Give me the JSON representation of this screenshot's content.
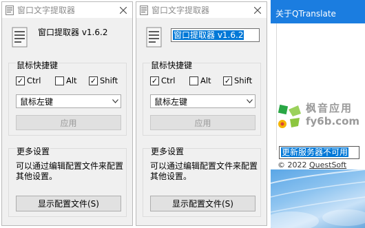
{
  "windows": [
    {
      "title": "窗口文字提取器",
      "app_title": "窗口提取器 v1.6.2",
      "app_title_selected": false,
      "hotkey_group": "鼠标快捷键",
      "checkboxes": [
        {
          "label": "Ctrl",
          "checked": true
        },
        {
          "label": "Alt",
          "checked": false
        },
        {
          "label": "Shift",
          "checked": true
        }
      ],
      "combo_value": "鼠标左键",
      "apply_label": "应用",
      "more_group": "更多设置",
      "more_text": "可以通过编辑配置文件来配置其他设置。",
      "show_config_label": "显示配置文件(S)"
    },
    {
      "title": "窗口文字提取器",
      "app_title": "窗口提取器 v1.6.2",
      "app_title_selected": true,
      "hotkey_group": "鼠标快捷键",
      "checkboxes": [
        {
          "label": "Ctrl",
          "checked": true
        },
        {
          "label": "Alt",
          "checked": false
        },
        {
          "label": "Shift",
          "checked": true
        }
      ],
      "combo_value": "鼠标左键",
      "apply_label": "应用",
      "more_group": "更多设置",
      "more_text": "可以通过编辑配置文件来配置其他设置。",
      "show_config_label": "显示配置文件(S)"
    }
  ],
  "about": {
    "title": "关于QTranslate",
    "watermark_line1": "枫音应用",
    "watermark_line2": "fy6b.com",
    "update_status": "更新服务器不可用",
    "copyright_prefix": "© 2022 ",
    "copyright_link": "QuestSoft"
  },
  "icons": {
    "checkmark": "✓",
    "close": "close-icon",
    "dropdown": "chevron-down-icon",
    "app": "document-icon"
  },
  "colors": {
    "about_titlebar": "#1b7de0",
    "selection": "#0078d7",
    "dialog_bg": "#f0f0f0"
  }
}
